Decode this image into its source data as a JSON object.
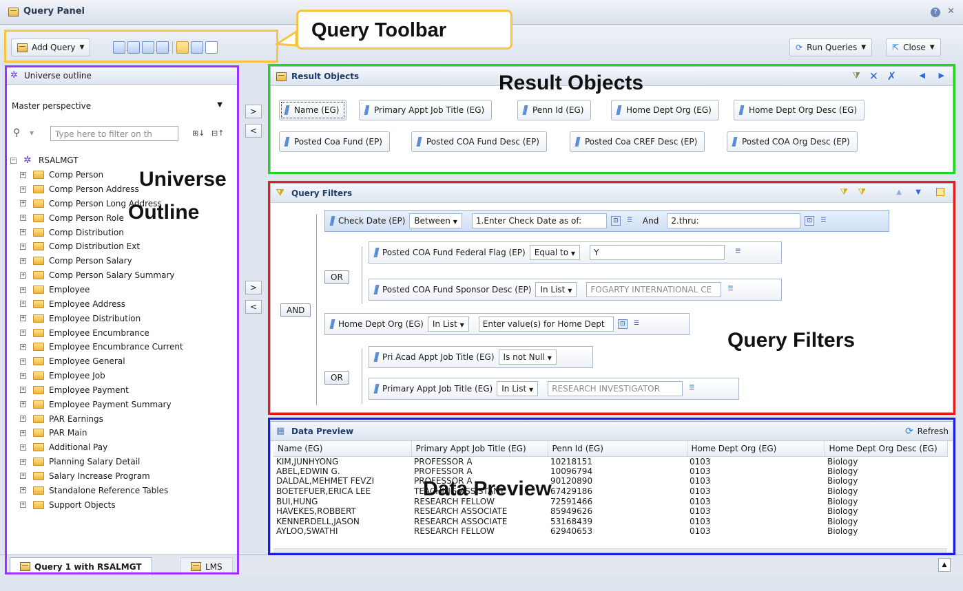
{
  "app": {
    "title": "Query Panel"
  },
  "titlebar": {
    "help": "?",
    "close": "✕"
  },
  "toolbar": {
    "add_query": "Add Query",
    "run_queries": "Run Queries",
    "close": "Close"
  },
  "annotations": {
    "query_toolbar": "Query Toolbar",
    "result_objects": "Result Objects",
    "universe_outline_line1": "Universe",
    "universe_outline_line2": "Outline",
    "query_filters": "Query Filters",
    "data_preview": "Data Preview"
  },
  "colors": {
    "toolbar_box": "#f5c542",
    "outline_box": "#9b30ff",
    "result_box": "#22d622",
    "filter_box": "#e81a1a",
    "preview_box": "#1a1ae8"
  },
  "universe": {
    "header": "Universe outline",
    "perspective": "Master perspective",
    "filter_placeholder": "Type here to filter on th",
    "root": "RSALMGT",
    "folders": [
      "Comp Person",
      "Comp Person Address",
      "Comp Person Long Address",
      "Comp Person Role",
      "Comp Distribution",
      "Comp Distribution Ext",
      "Comp Person Salary",
      "Comp Person Salary Summary",
      "Employee",
      "Employee Address",
      "Employee Distribution",
      "Employee Encumbrance",
      "Employee Encumbrance Current",
      "Employee General",
      "Employee Job",
      "Employee Payment",
      "Employee Payment Summary",
      "PAR Earnings",
      "PAR Main",
      "Additional Pay",
      "Planning Salary Detail",
      "Salary Increase Program",
      "Standalone Reference Tables",
      "Support Objects"
    ]
  },
  "tabs": {
    "query1": "Query 1 with RSALMGT",
    "lms": "LMS"
  },
  "result_objects": {
    "header": "Result Objects",
    "items": [
      "Name (EG)",
      "Primary Appt Job Title (EG)",
      "Penn Id (EG)",
      "Home Dept Org (EG)",
      "Home Dept Org Desc (EG)",
      "Posted Coa Fund (EP)",
      "Posted COA Fund Desc (EP)",
      "Posted Coa CREF Desc (EP)",
      "Posted COA Org Desc (EP)"
    ]
  },
  "query_filters": {
    "header": "Query Filters",
    "and_label": "AND",
    "or_label": "OR",
    "f1": {
      "name": "Check Date (EP)",
      "op": "Between",
      "val1": "1.Enter Check Date as of:",
      "and": "And",
      "val2": "2.thru:"
    },
    "f2": {
      "name": "Posted COA Fund Federal Flag (EP)",
      "op": "Equal to",
      "val": "Y"
    },
    "f3": {
      "name": "Posted COA Fund Sponsor Desc (EP)",
      "op": "In List",
      "val": "FOGARTY INTERNATIONAL CE"
    },
    "f4": {
      "name": "Home Dept Org (EG)",
      "op": "In List",
      "val": "Enter value(s) for Home Dept"
    },
    "f5": {
      "name": "Pri Acad Appt Job Title (EG)",
      "op": "Is not Null"
    },
    "f6": {
      "name": "Primary Appt Job Title (EG)",
      "op": "In List",
      "val": "RESEARCH INVESTIGATOR"
    }
  },
  "data_preview": {
    "header": "Data Preview",
    "refresh": "Refresh",
    "columns": [
      "Name (EG)",
      "Primary Appt Job Title (EG)",
      "Penn Id (EG)",
      "Home Dept Org (EG)",
      "Home Dept Org Desc (EG)"
    ],
    "rows": [
      [
        "KIM,JUNHYONG",
        "PROFESSOR A",
        "10218151",
        "0103",
        "Biology"
      ],
      [
        "ABEL,EDWIN G.",
        "PROFESSOR A",
        "10096794",
        "0103",
        "Biology"
      ],
      [
        "DALDAL,MEHMET FEVZI",
        "PROFESSOR A",
        "90120890",
        "0103",
        "Biology"
      ],
      [
        "BOETEFUER,ERICA LEE",
        "TEACHING ASSISTANT",
        "67429186",
        "0103",
        "Biology"
      ],
      [
        "BUI,HUNG",
        "RESEARCH FELLOW",
        "72591466",
        "0103",
        "Biology"
      ],
      [
        "HAVEKES,ROBBERT",
        "RESEARCH ASSOCIATE",
        "85949626",
        "0103",
        "Biology"
      ],
      [
        "KENNERDELL,JASON",
        "RESEARCH ASSOCIATE",
        "53168439",
        "0103",
        "Biology"
      ],
      [
        "AYLOO,SWATHI",
        "RESEARCH FELLOW",
        "62940653",
        "0103",
        "Biology"
      ]
    ]
  }
}
